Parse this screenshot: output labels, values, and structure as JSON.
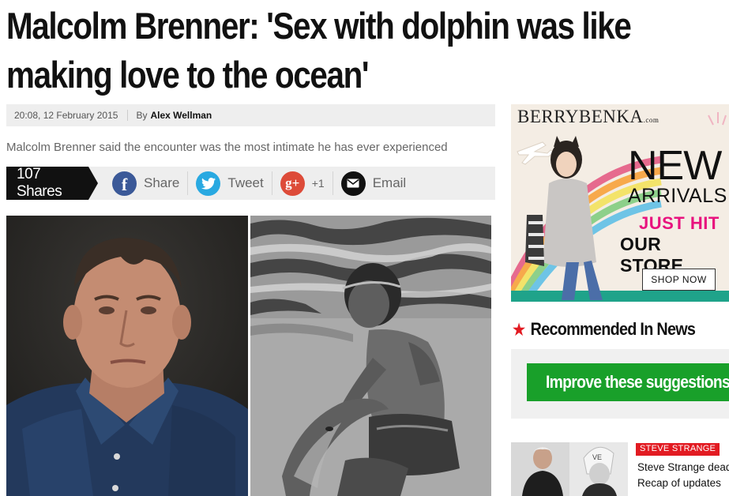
{
  "article": {
    "headline": "Malcolm Brenner: 'Sex with dolphin was like making love to the ocean'",
    "timestamp": "20:08, 12 February 2015",
    "by_label": "By",
    "author": "Alex Wellman",
    "standfirst": "Malcolm Brenner said the encounter was the most intimate he has ever experienced"
  },
  "share_bar": {
    "shares": "107 Shares",
    "facebook_label": "Share",
    "twitter_label": "Tweet",
    "googleplus_label": "+1",
    "email_label": "Email",
    "facebook_glyph": "f",
    "googleplus_glyph": "g+",
    "facebook_color": "#3b5998",
    "twitter_color": "#29a9e1",
    "googleplus_color": "#dd4b39",
    "email_color": "#111111"
  },
  "ad": {
    "brand": "BERRYBENKA",
    "brand_suffix": ".com",
    "headline_1": "NEW",
    "headline_2": "ARRIVALS",
    "line_1": "JUST HIT",
    "line_2": "OUR STORE",
    "cta": "SHOP NOW"
  },
  "sidebar": {
    "recommended_title": "Recommended In News",
    "improve_label": "Improve these suggestions",
    "story": {
      "tag": "STEVE STRANGE",
      "title_line_1": "Steve Strange dead",
      "title_line_2": "Recap of updates"
    }
  },
  "colors": {
    "accent_red": "#e21b22",
    "improve_green": "#19a02a",
    "ad_pink": "#e8127e"
  }
}
